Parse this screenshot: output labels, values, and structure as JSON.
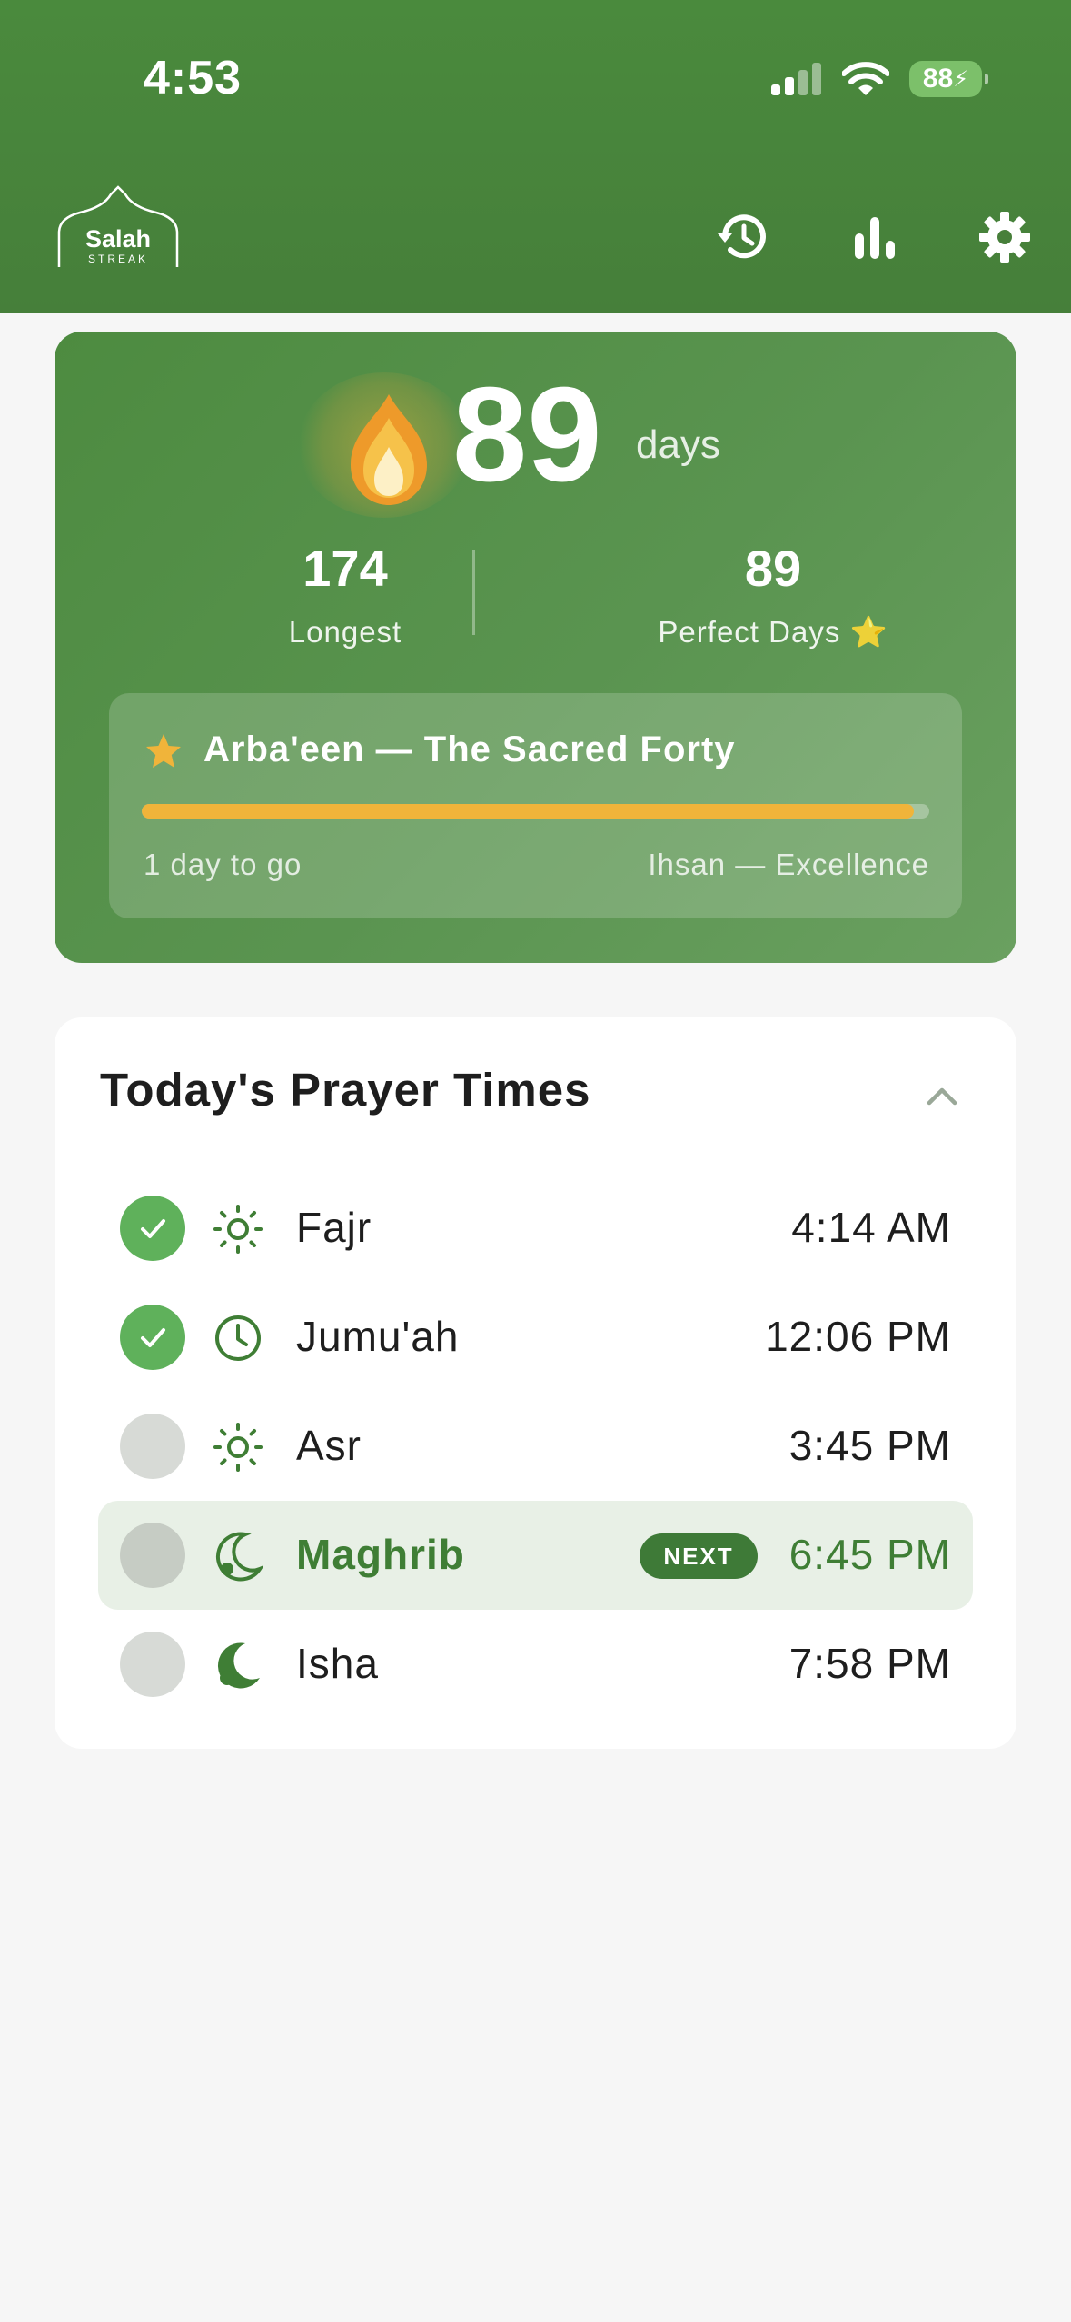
{
  "status_bar": {
    "time": "4:53",
    "battery": "88"
  },
  "header": {
    "logo_title": "Salah",
    "logo_subtitle": "STREAK",
    "icons": [
      "history-icon",
      "bar-chart-icon",
      "gear-icon"
    ]
  },
  "streak": {
    "count": "89",
    "unit": "days",
    "longest_value": "174",
    "longest_label": "Longest",
    "perfect_value": "89",
    "perfect_label": "Perfect Days ⭐",
    "milestone": {
      "title": "Arba'een — The Sacred Forty",
      "progress": 0.98,
      "remaining": "1 day to go",
      "level": "Ihsan — Excellence"
    }
  },
  "prayers": {
    "title": "Today's Prayer Times",
    "items": [
      {
        "name": "Fajr",
        "time": "4:14 AM",
        "done": true,
        "icon": "sun-icon",
        "next": false
      },
      {
        "name": "Jumu'ah",
        "time": "12:06 PM",
        "done": true,
        "icon": "clock-icon",
        "next": false
      },
      {
        "name": "Asr",
        "time": "3:45 PM",
        "done": false,
        "icon": "sun-icon",
        "next": false
      },
      {
        "name": "Maghrib",
        "time": "6:45 PM",
        "done": false,
        "icon": "crescent-moon-icon",
        "next": true,
        "badge": "NEXT"
      },
      {
        "name": "Isha",
        "time": "7:58 PM",
        "done": false,
        "icon": "crescent-moon-icon",
        "next": false
      }
    ]
  },
  "colors": {
    "header_green": "#4a8a3d",
    "accent_orange": "#f0b43a",
    "check_green": "#5fb15b",
    "next_green": "#3f7e35"
  }
}
